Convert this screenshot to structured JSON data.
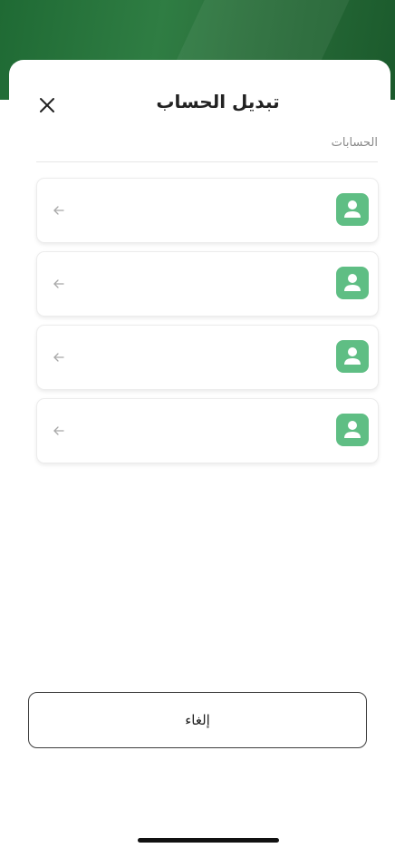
{
  "sheet": {
    "title": "تبديل الحساب",
    "section_label": "الحسابات"
  },
  "accounts": [
    {
      "name": "",
      "icon": "user-avatar-icon"
    },
    {
      "name": "",
      "icon": "user-avatar-icon"
    },
    {
      "name": "",
      "icon": "user-avatar-icon"
    },
    {
      "name": "",
      "icon": "user-avatar-icon"
    }
  ],
  "actions": {
    "cancel_label": "إلغاء",
    "close_icon": "close-icon"
  },
  "colors": {
    "header_green": "#2a6f3b",
    "avatar_green": "#5fbe84",
    "text_dark": "#222222",
    "text_muted": "#8a8a8a"
  }
}
